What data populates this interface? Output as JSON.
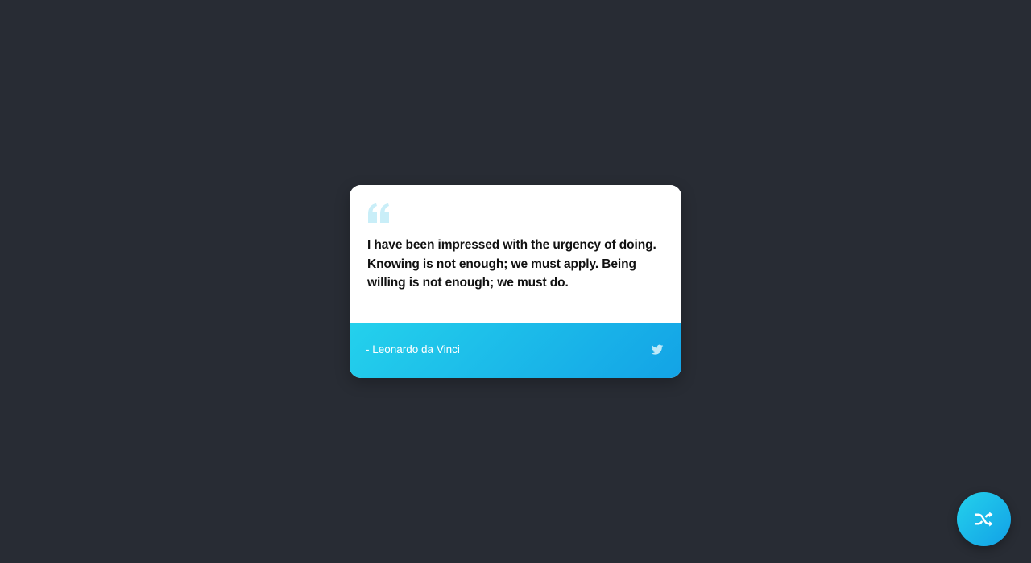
{
  "quote": {
    "text": "I have been impressed with the urgency of doing. Knowing is not enough; we must apply. Being willing is not enough; we must do.",
    "author": "- Leonardo da Vinci",
    "quote_icon": "quote-left-icon",
    "share_icon": "twitter-icon"
  },
  "actions": {
    "shuffle_icon": "shuffle-icon"
  },
  "colors": {
    "background": "#282c34",
    "card": "#ffffff",
    "accent_start": "#24d1ec",
    "accent_end": "#13a3e6",
    "quote_mark": "#c9eef8"
  }
}
